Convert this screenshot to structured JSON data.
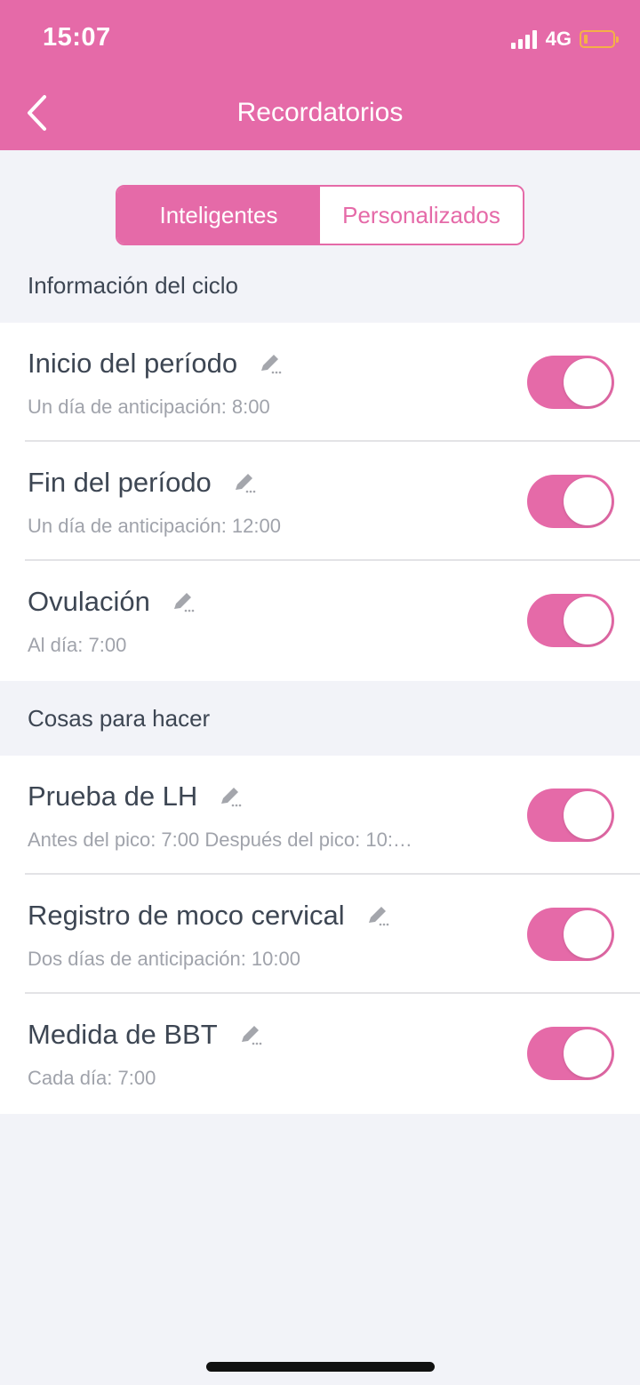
{
  "status_bar": {
    "time": "15:07",
    "network": "4G"
  },
  "nav": {
    "title": "Recordatorios"
  },
  "tabs": [
    {
      "label": "Inteligentes"
    },
    {
      "label": "Personalizados"
    }
  ],
  "sections": [
    {
      "title": "Información del ciclo",
      "items": [
        {
          "title": "Inicio del período",
          "subtitle": "Un día de anticipación: 8:00",
          "enabled": true
        },
        {
          "title": "Fin del período",
          "subtitle": "Un día de anticipación: 12:00",
          "enabled": true
        },
        {
          "title": "Ovulación",
          "subtitle": "Al día: 7:00",
          "enabled": true
        }
      ]
    },
    {
      "title": "Cosas para hacer",
      "items": [
        {
          "title": "Prueba de LH",
          "subtitle": "Antes del pico: 7:00  Después del pico: 10:…",
          "enabled": true
        },
        {
          "title": "Registro de moco cervical",
          "subtitle": "Dos días de anticipación: 10:00",
          "enabled": true
        },
        {
          "title": "Medida de BBT",
          "subtitle": "Cada día: 7:00",
          "enabled": true
        }
      ]
    }
  ],
  "colors": {
    "accent": "#e56aa8",
    "background": "#f2f3f8",
    "text": "#3d4653",
    "subtext": "#a0a3ab"
  }
}
